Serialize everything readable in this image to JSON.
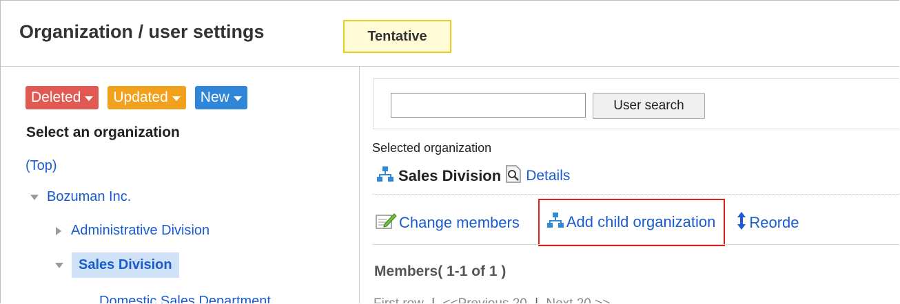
{
  "header": {
    "title": "Organization / user settings",
    "status_badge": "Tentative"
  },
  "left_pane": {
    "filters": [
      {
        "label": "Deleted",
        "color": "#e05a53"
      },
      {
        "label": "Updated",
        "color": "#f1a11e"
      },
      {
        "label": "New",
        "color": "#2f86d9"
      }
    ],
    "heading": "Select an organization",
    "top_link": "(Top)",
    "tree": {
      "root": "Bozuman Inc.",
      "items": [
        {
          "label": "Administrative Division",
          "state": "collapsed"
        },
        {
          "label": "Sales Division",
          "state": "expanded",
          "selected": true
        },
        {
          "label": "Domestic Sales Department"
        }
      ]
    }
  },
  "right_pane": {
    "search": {
      "value": "",
      "button_label": "User search"
    },
    "selected_label": "Selected organization",
    "selected_org": "Sales Division",
    "details_link": "Details",
    "actions": {
      "change_members": "Change members",
      "add_child": "Add child organization",
      "reorder": "Reorde"
    },
    "members_title": "Members( 1-1 of 1 )",
    "pager": {
      "first": "First row",
      "previous": "<<Previous 20",
      "next": "Next 20 >>",
      "separator": "|"
    }
  },
  "colors": {
    "link": "#1a5bd0",
    "highlight_border": "#e21b1b",
    "tentative_bg": "#fffbd6",
    "tentative_border": "#e7cc1b",
    "selected_bg": "#cfe2f7"
  },
  "icons": [
    "chevron-down-icon",
    "org-icon",
    "magnifier-icon",
    "edit-icon",
    "reorder-icon",
    "triangle-expanded-icon",
    "triangle-collapsed-icon"
  ]
}
